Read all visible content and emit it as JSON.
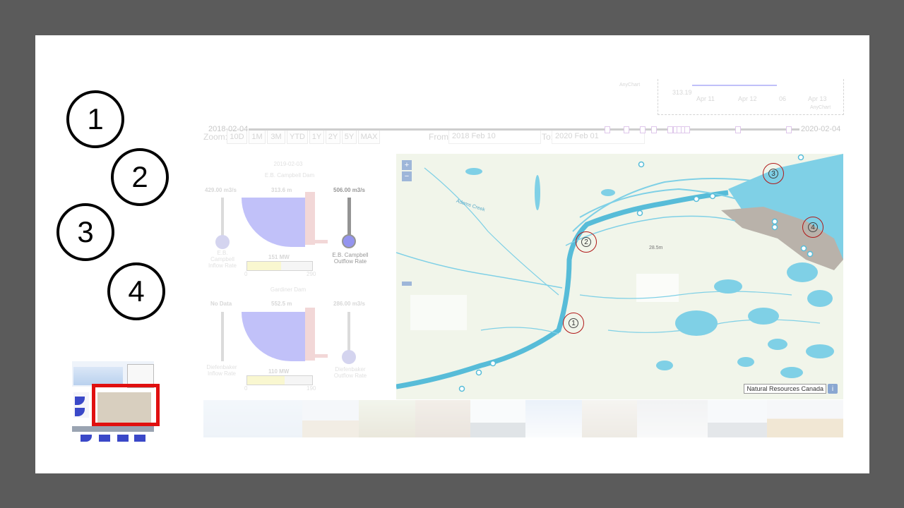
{
  "callouts": [
    "1",
    "2",
    "3",
    "4"
  ],
  "toolbar": {
    "zoom_label": "Zoom:",
    "zoom_buttons": [
      "10D",
      "1M",
      "3M",
      "YTD",
      "1Y",
      "2Y",
      "5Y",
      "MAX"
    ],
    "from_label": "From:",
    "from_value": "2018 Feb 10",
    "to_label": "To:",
    "to_value": "2020 Feb 01"
  },
  "mini_chart": {
    "y_value": "313.19",
    "x_ticks": [
      "Apr 11",
      "Apr 12",
      "06",
      "Apr 13"
    ],
    "credit": "AnyChart",
    "credit_top": "AnyChart"
  },
  "timeline": {
    "start": "2018-02-04",
    "end": "2020-02-04"
  },
  "dams": {
    "date": "2019-02-03",
    "campbell": {
      "name": "E.B. Campbell Dam",
      "inflow": "429.00 m3/s",
      "level": "313.6 m",
      "outflow": "506.00 m3/s",
      "inflow_label": "E.B. Campbell Inflow Rate",
      "outflow_label": "E.B. Campbell Outflow Rate",
      "power": "151 MW",
      "power_min": "0",
      "power_max": "290",
      "power_fraction": 0.52
    },
    "gardiner": {
      "name": "Gardiner Dam",
      "inflow": "No Data",
      "level": "552.5 m",
      "outflow": "286.00 m3/s",
      "inflow_label": "Diefenbaker Inflow Rate",
      "outflow_label": "Diefenbaker Outflow Rate",
      "power": "110 MW",
      "power_min": "0",
      "power_max": "190",
      "power_fraction": 0.58
    }
  },
  "map": {
    "zoom_in": "+",
    "zoom_out": "−",
    "markers": [
      "1",
      "2",
      "3",
      "4"
    ],
    "elevation_label": "28.5m",
    "creek_label": "Adams Creek",
    "attribution": "Natural Resources Canada",
    "info": "i"
  },
  "colors": {
    "slide_bg": "#ffffff",
    "frame_bg": "#5b5b5b",
    "water": "#7fd0e6",
    "land": "#f1f5ea",
    "highlight": "#e01010"
  }
}
